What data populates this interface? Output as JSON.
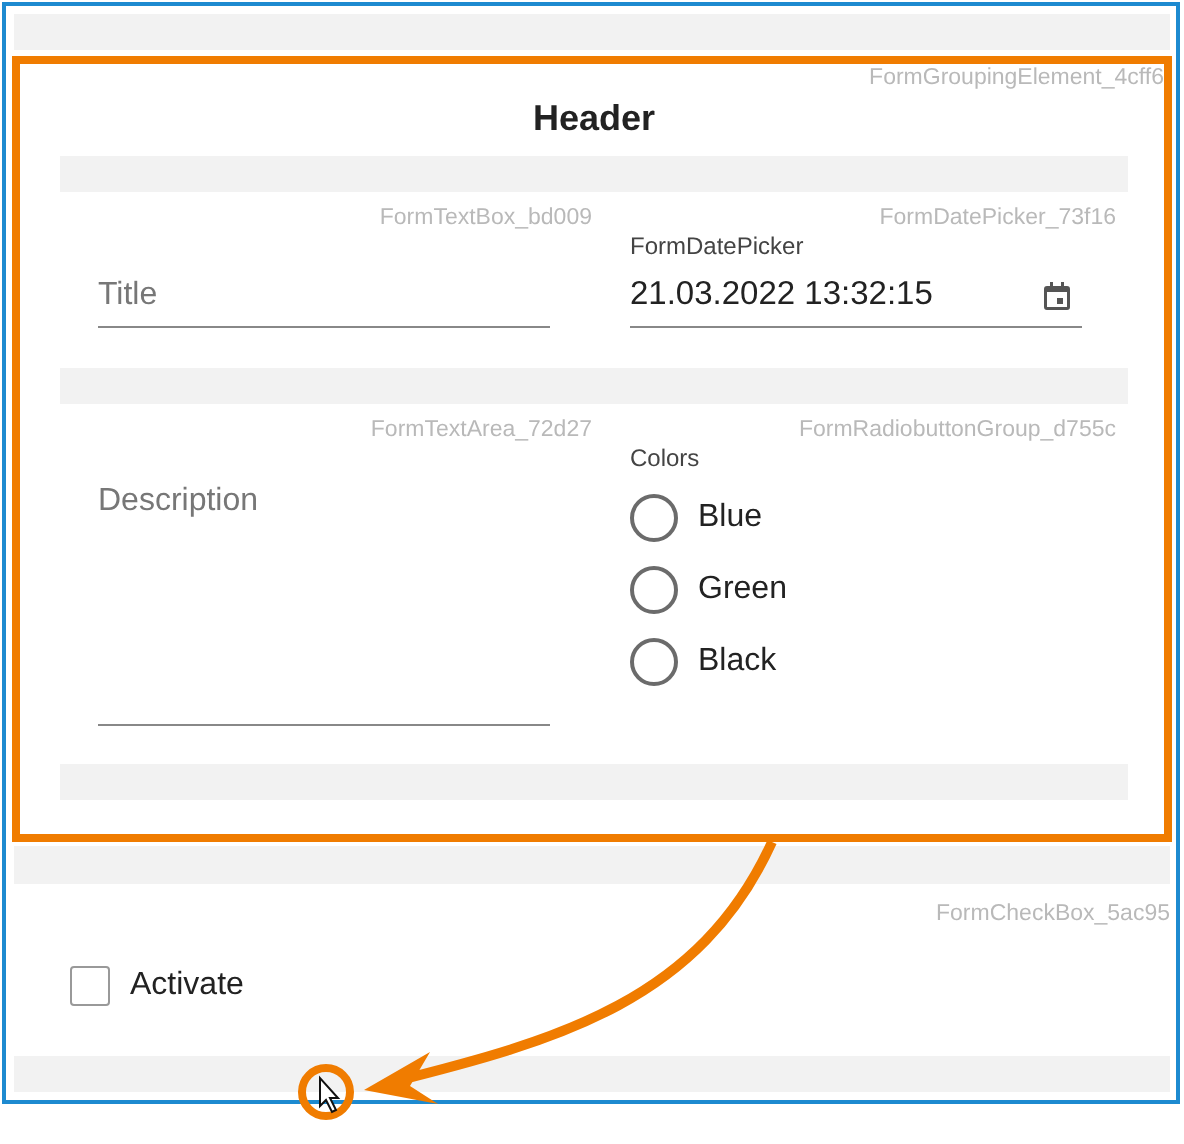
{
  "group": {
    "caption": "FormGroupingElement_4cff6",
    "header": "Header",
    "rows": [
      {
        "cells": [
          {
            "kind": "textbox",
            "caption": "FormTextBox_bd009",
            "placeholder": "Title"
          },
          {
            "kind": "datepicker",
            "caption": "FormDatePicker_73f16",
            "label": "FormDatePicker",
            "value": "21.03.2022 13:32:15"
          }
        ]
      },
      {
        "cells": [
          {
            "kind": "textarea",
            "caption": "FormTextArea_72d27",
            "placeholder": "Description"
          },
          {
            "kind": "radiogroup",
            "caption": "FormRadiobuttonGroup_d755c",
            "label": "Colors",
            "options": [
              {
                "label": "Blue",
                "selected": false
              },
              {
                "label": "Green",
                "selected": false
              },
              {
                "label": "Black",
                "selected": false
              }
            ]
          }
        ]
      }
    ]
  },
  "checkbox": {
    "caption": "FormCheckBox_5ac95",
    "label": "Activate",
    "checked": false
  }
}
